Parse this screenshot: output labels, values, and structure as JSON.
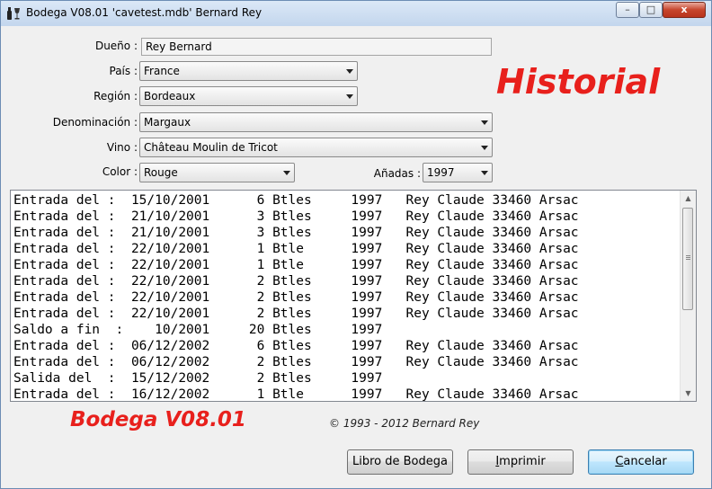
{
  "window": {
    "title": "Bodega V08.01 'cavetest.mdb'   Bernard Rey",
    "min_glyph": "–",
    "max_glyph": "□",
    "close_glyph": "x"
  },
  "form": {
    "owner_label": "Dueño :",
    "owner_value": "Rey Bernard",
    "country_label": "País :",
    "country_value": "France",
    "region_label": "Región :",
    "region_value": "Bordeaux",
    "denomination_label": "Denominación :",
    "denomination_value": "Margaux",
    "wine_label": "Vino :",
    "wine_value": "Château Moulin de Tricot",
    "color_label": "Color :",
    "color_value": "Rouge",
    "vintage_label": "Añadas :",
    "vintage_value": "1997"
  },
  "heading": "Historial",
  "history": [
    {
      "text": "Entrada del :  15/10/2001      6 Btles     1997   Rey Claude 33460 Arsac"
    },
    {
      "text": "Entrada del :  21/10/2001      3 Btles     1997   Rey Claude 33460 Arsac"
    },
    {
      "text": "Entrada del :  21/10/2001      3 Btles     1997   Rey Claude 33460 Arsac"
    },
    {
      "text": "Entrada del :  22/10/2001      1 Btle      1997   Rey Claude 33460 Arsac"
    },
    {
      "text": "Entrada del :  22/10/2001      1 Btle      1997   Rey Claude 33460 Arsac"
    },
    {
      "text": "Entrada del :  22/10/2001      2 Btles     1997   Rey Claude 33460 Arsac"
    },
    {
      "text": "Entrada del :  22/10/2001      2 Btles     1997   Rey Claude 33460 Arsac"
    },
    {
      "text": "Entrada del :  22/10/2001      2 Btles     1997   Rey Claude 33460 Arsac"
    },
    {
      "text": "Saldo a fin  :    10/2001     20 Btles     1997"
    },
    {
      "text": "Entrada del :  06/12/2002      6 Btles     1997   Rey Claude 33460 Arsac"
    },
    {
      "text": "Entrada del :  06/12/2002      2 Btles     1997   Rey Claude 33460 Arsac"
    },
    {
      "text": "Salida del  :  15/12/2002      2 Btles     1997"
    },
    {
      "text": "Entrada del :  16/12/2002      1 Btle      1997   Rey Claude 33460 Arsac"
    }
  ],
  "footer": {
    "brand": "Bodega V08.01",
    "copyright": "© 1993 - 2012 Bernard Rey"
  },
  "buttons": {
    "cellar_book": "Libro de Bodega",
    "print_first": "I",
    "print_rest": "mprimir",
    "cancel_first": "C",
    "cancel_rest": "ancelar"
  },
  "icons": {
    "app": "wine-bottle-glass-icon",
    "dropdown": "chevron-down-icon"
  }
}
